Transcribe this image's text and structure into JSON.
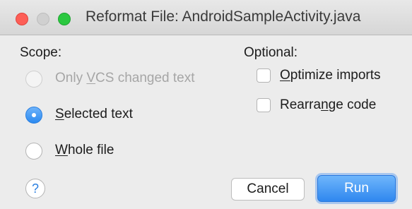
{
  "window": {
    "title": "Reformat File: AndroidSampleActivity.java"
  },
  "scope": {
    "label": "Scope:",
    "options": [
      {
        "pre": "Only ",
        "mnemonic": "V",
        "post": "CS changed text",
        "state": "disabled"
      },
      {
        "pre": "",
        "mnemonic": "S",
        "post": "elected text",
        "state": "checked"
      },
      {
        "pre": "",
        "mnemonic": "W",
        "post": "hole file",
        "state": "unchecked"
      }
    ]
  },
  "optional": {
    "label": "Optional:",
    "options": [
      {
        "pre": "",
        "mnemonic": "O",
        "post": "ptimize imports",
        "checked": false
      },
      {
        "pre": "Rearra",
        "mnemonic": "n",
        "post": "ge code",
        "checked": false
      }
    ]
  },
  "buttons": {
    "help": "?",
    "cancel": "Cancel",
    "run": "Run"
  },
  "colors": {
    "accent": "#2c8af0",
    "close": "#fd5e56",
    "zoom": "#2bc840"
  }
}
